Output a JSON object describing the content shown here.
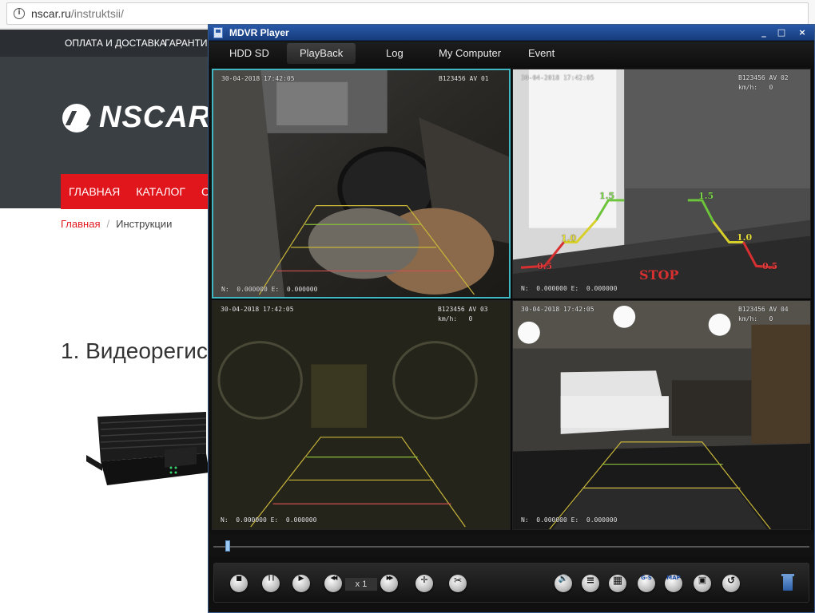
{
  "browser": {
    "url_host": "nscar.ru",
    "url_path": "/instruktsii/"
  },
  "site": {
    "topbar_links": [
      "Оплата и доставка",
      "Гарантия"
    ],
    "logo_text": "NSCAR",
    "nav_items": [
      "Главная",
      "Каталог",
      "С"
    ],
    "breadcrumb": {
      "home": "Главная",
      "separator": "/",
      "current": "Инструкции"
    },
    "article_heading": "1. Видеорегис",
    "accent_color": "#e1161d"
  },
  "player": {
    "title": "MDVR Player",
    "window_controls": [
      "_",
      "□",
      "×"
    ],
    "tabs": [
      {
        "label": "HDD SD",
        "active": false
      },
      {
        "label": "PlayBack",
        "active": true
      },
      {
        "label": "Log",
        "active": false
      },
      {
        "label": "My Computer",
        "active": false
      },
      {
        "label": "Event",
        "active": false
      }
    ],
    "cameras": [
      {
        "datetime": "30-04-2018 17:42:05",
        "id": "B123456 AV 01",
        "speed": "",
        "coords": "N:  0.000000 E:  0.000000",
        "selected": true
      },
      {
        "datetime": "30-04-2018 17:42:05",
        "id": "B123456 AV 02",
        "speed": "km/h:   0",
        "coords": "N:  0.000000 E:  0.000000",
        "selected": false,
        "guides": [
          "1.5",
          "1.5",
          "1.0",
          "1.0",
          "0.5",
          "0.5"
        ],
        "stop_label": "STOP"
      },
      {
        "datetime": "30-04-2018 17:42:05",
        "id": "B123456 AV 03",
        "speed": "km/h:   0",
        "coords": "N:  0.000000 E:  0.000000",
        "selected": false
      },
      {
        "datetime": "30-04-2018 17:42:05",
        "id": "B123456 AV 04",
        "speed": "km/h:   0",
        "coords": "N:  0.000000 E:  0.000000",
        "selected": false
      }
    ],
    "playback_speed": "x 1",
    "seek_position": 0.02,
    "selected_border_color": "#3fb8c4"
  }
}
